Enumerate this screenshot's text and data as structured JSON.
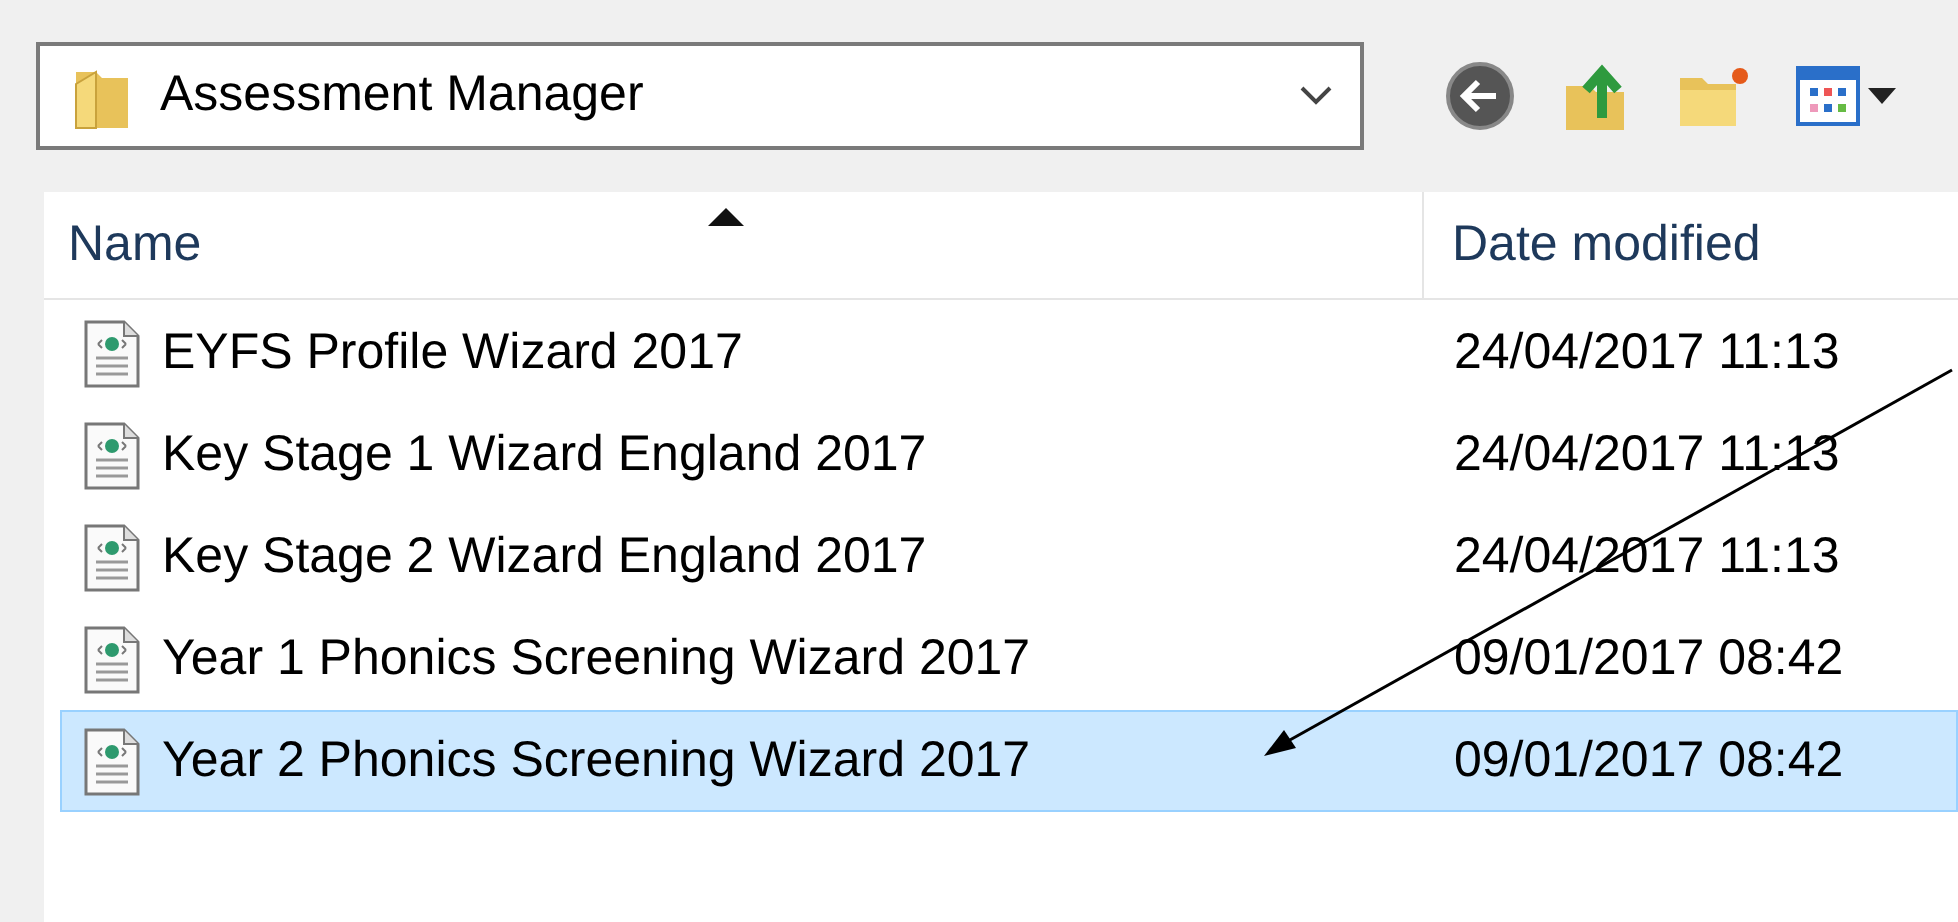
{
  "location": {
    "text": "Assessment Manager"
  },
  "table": {
    "columns": [
      "Name",
      "Date modified"
    ],
    "rows": [
      {
        "name": "EYFS Profile Wizard 2017",
        "date": "24/04/2017 11:13",
        "selected": false
      },
      {
        "name": "Key Stage 1 Wizard England 2017",
        "date": "24/04/2017 11:13",
        "selected": false
      },
      {
        "name": "Key Stage 2 Wizard England 2017",
        "date": "24/04/2017 11:13",
        "selected": false
      },
      {
        "name": "Year 1 Phonics Screening Wizard 2017",
        "date": "09/01/2017 08:42",
        "selected": false
      },
      {
        "name": "Year 2 Phonics Screening Wizard 2017",
        "date": "09/01/2017 08:42",
        "selected": true
      }
    ]
  }
}
